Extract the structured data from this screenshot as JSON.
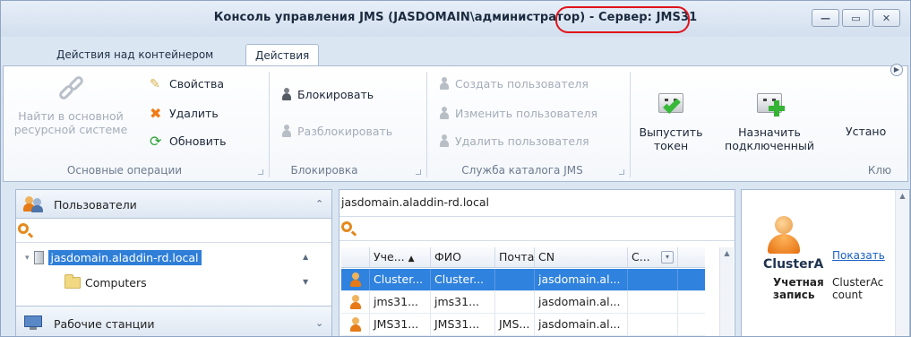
{
  "window": {
    "title_main": "Консоль управления JMS (JASDOMAIN\\администратор) - ",
    "title_server": "Сервер: JMS31",
    "buttons": {
      "minimize": "—",
      "maximize": "▭",
      "close": "✕"
    }
  },
  "tabs": [
    {
      "label": "Действия над контейнером",
      "active": false
    },
    {
      "label": "Действия",
      "active": true
    }
  ],
  "ribbon": {
    "basic": {
      "label": "Основные операции",
      "find_line1": "Найти в основной",
      "find_line2": "ресурсной системе",
      "properties": "Свойства",
      "delete": "Удалить",
      "refresh": "Обновить"
    },
    "lock": {
      "label": "Блокировка",
      "lock": "Блокировать",
      "unlock": "Разблокировать"
    },
    "catalog": {
      "label": "Служба каталога JMS",
      "create_user": "Создать пользователя",
      "edit_user": "Изменить пользователя",
      "delete_user": "Удалить пользователя"
    },
    "keys": {
      "label": "Клю",
      "issue_line1": "Выпустить",
      "issue_line2": "токен",
      "assign_line1": "Назначить",
      "assign_line2": "подключенный",
      "install": "Устано"
    }
  },
  "left_pane": {
    "users_header": "Пользователи",
    "tree": {
      "domain": "jasdomain.aladdin-rd.local",
      "computers": "Computers"
    },
    "workstations_header": "Рабочие станции"
  },
  "middle_pane": {
    "path": "jasdomain.aladdin-rd.local",
    "columns": [
      "Уче...",
      "ФИО",
      "Почта",
      "CN",
      "С..."
    ],
    "rows": [
      [
        "Cluster...",
        "Cluster...",
        "",
        "jasdomain.al...",
        ""
      ],
      [
        "jms31...",
        "jms31...",
        "",
        "jasdomain.al...",
        ""
      ],
      [
        "JMS31...",
        "JMS31...",
        "JMS...",
        "jasdomain.al...",
        ""
      ]
    ]
  },
  "right_pane": {
    "name": "ClusterA",
    "show_link": "Показать",
    "account_label": "Учетная запись",
    "account_value": "ClusterAccount"
  }
}
